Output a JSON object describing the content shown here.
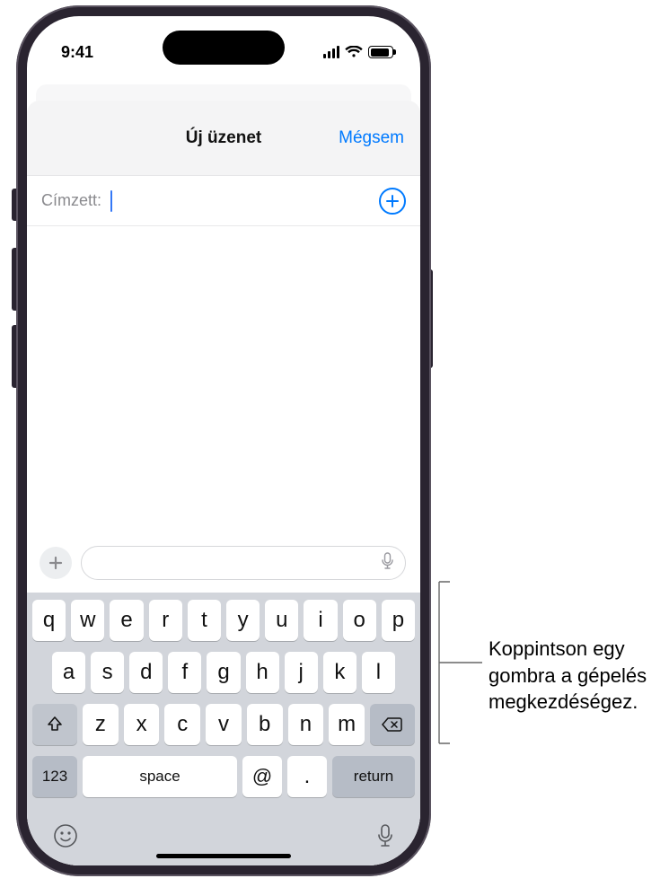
{
  "status": {
    "time": "9:41"
  },
  "modal": {
    "title": "Új üzenet",
    "cancel": "Mégsem"
  },
  "recipient": {
    "label": "Címzett:"
  },
  "keyboard": {
    "row1": [
      "q",
      "w",
      "e",
      "r",
      "t",
      "y",
      "u",
      "i",
      "o",
      "p"
    ],
    "row2": [
      "a",
      "s",
      "d",
      "f",
      "g",
      "h",
      "j",
      "k",
      "l"
    ],
    "row3": [
      "z",
      "x",
      "c",
      "v",
      "b",
      "n",
      "m"
    ],
    "numKey": "123",
    "spaceKey": "space",
    "atKey": "@",
    "dotKey": ".",
    "returnKey": "return"
  },
  "annotation": {
    "text": "Koppintson egy gombra a gépelés megkezdéségez."
  }
}
